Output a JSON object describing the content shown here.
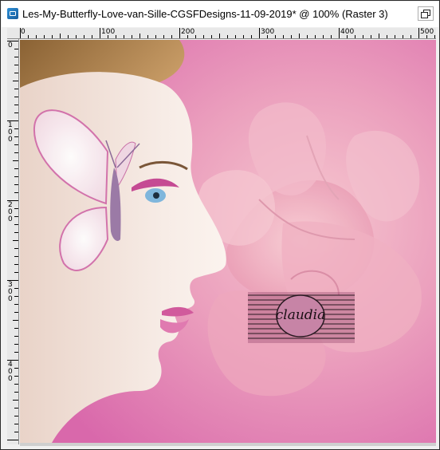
{
  "window": {
    "title": "Les-My-Butterfly-Love-van-Sille-CGSFDesigns-11-09-2019* @ 100% (Raster 3)"
  },
  "ruler": {
    "horizontal_labels": [
      "0",
      "100",
      "200",
      "300",
      "400",
      "500"
    ],
    "vertical_labels": [
      "0",
      "100",
      "200",
      "300",
      "400"
    ]
  },
  "image": {
    "watermark_text": "claudia",
    "colors": {
      "background_pink": "#d86aa8",
      "flower_pink": "#f1b3c4",
      "skin": "#f4e6df",
      "hair": "#b98b55"
    }
  },
  "icons": [
    "app-icon",
    "restore-icon"
  ]
}
